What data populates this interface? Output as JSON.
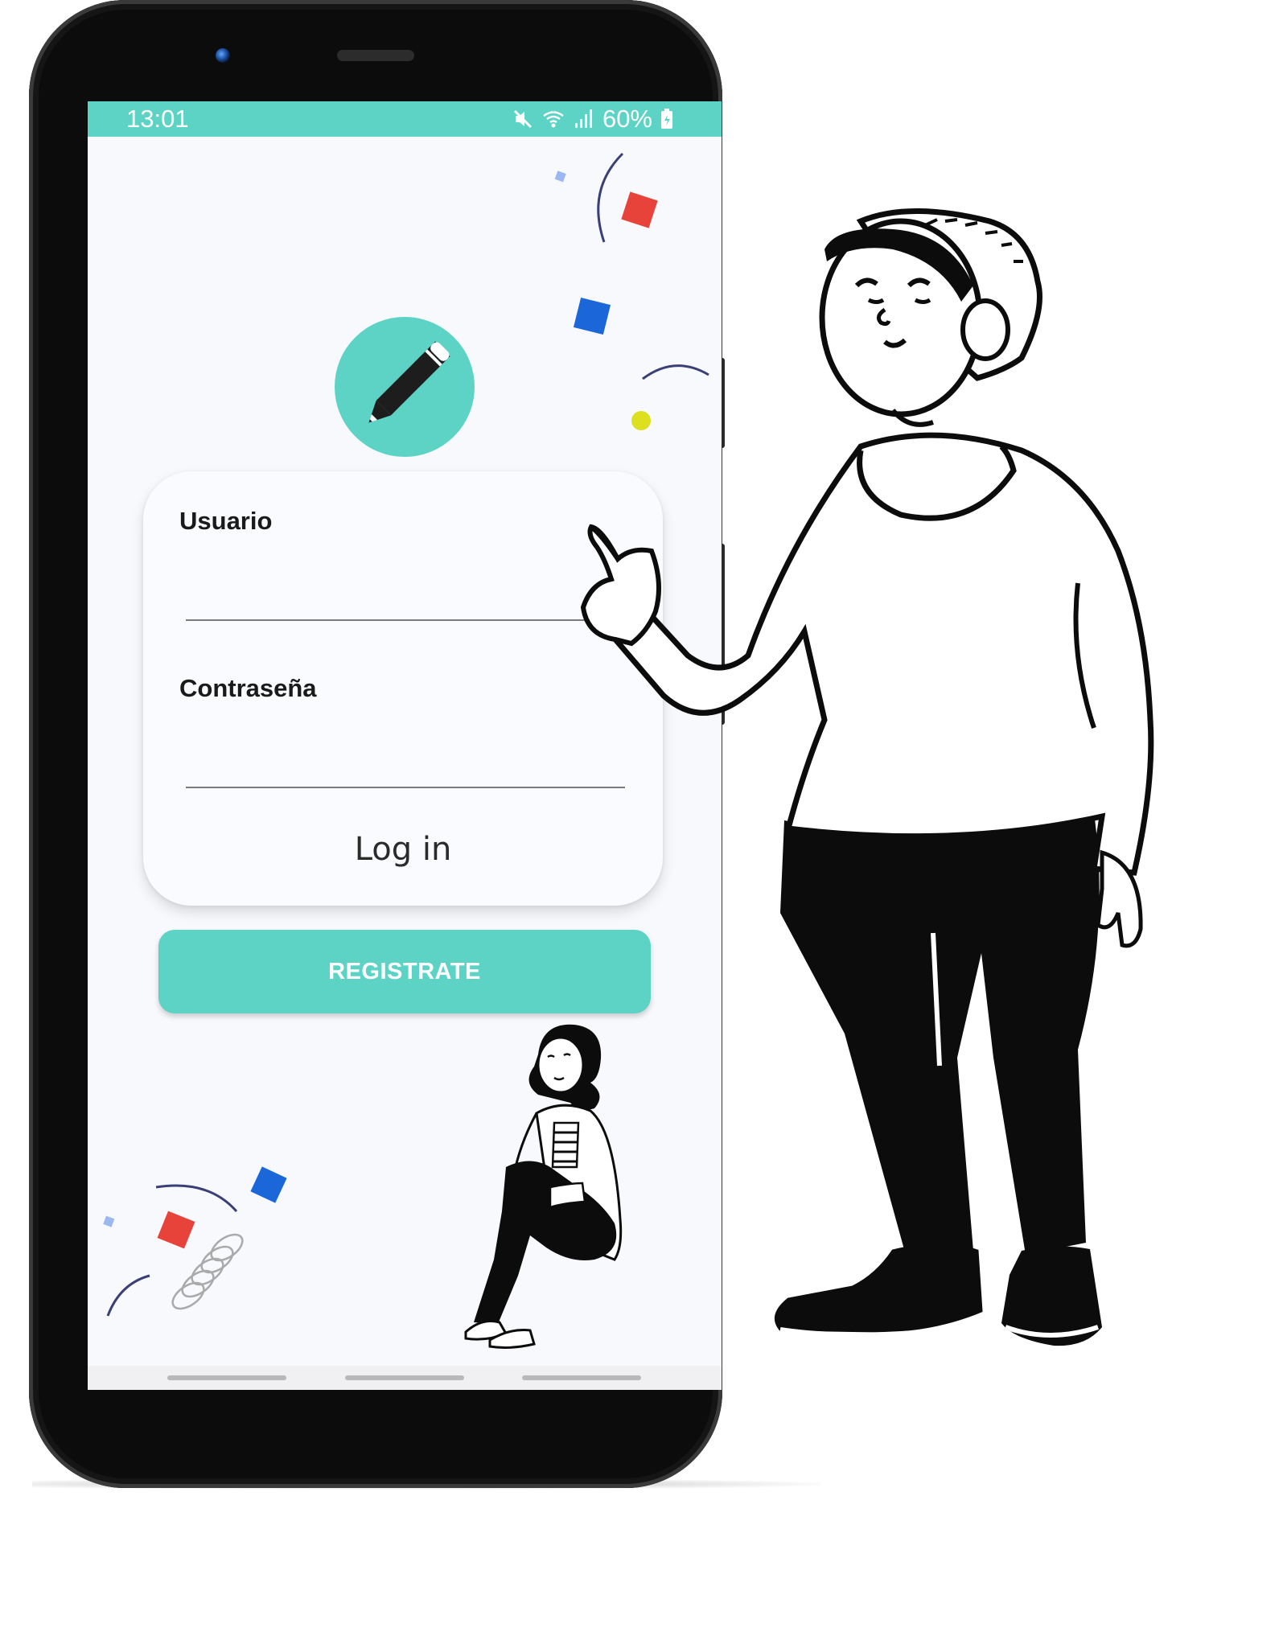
{
  "status_bar": {
    "time": "13:01",
    "battery_percent": "60%",
    "icons": [
      "mute-icon",
      "wifi-icon",
      "signal-icon",
      "battery-icon"
    ]
  },
  "login_form": {
    "username_label": "Usuario",
    "username_value": "",
    "password_label": "Contraseña",
    "password_value": "",
    "login_button": "Log in"
  },
  "register_button": "REGISTRATE",
  "colors": {
    "accent": "#5dd3c6",
    "screen_background": "#f7f9fd",
    "confetti_red": "#e8433b",
    "confetti_blue": "#1b66d8",
    "confetti_yellow": "#dde01e",
    "confetti_light_blue": "#9bb8f0",
    "arc_navy": "#3a3f78"
  },
  "illustrations": [
    "pencil-logo-icon",
    "sitting-woman-illustration",
    "pointing-man-illustration",
    "confetti-decoration"
  ]
}
